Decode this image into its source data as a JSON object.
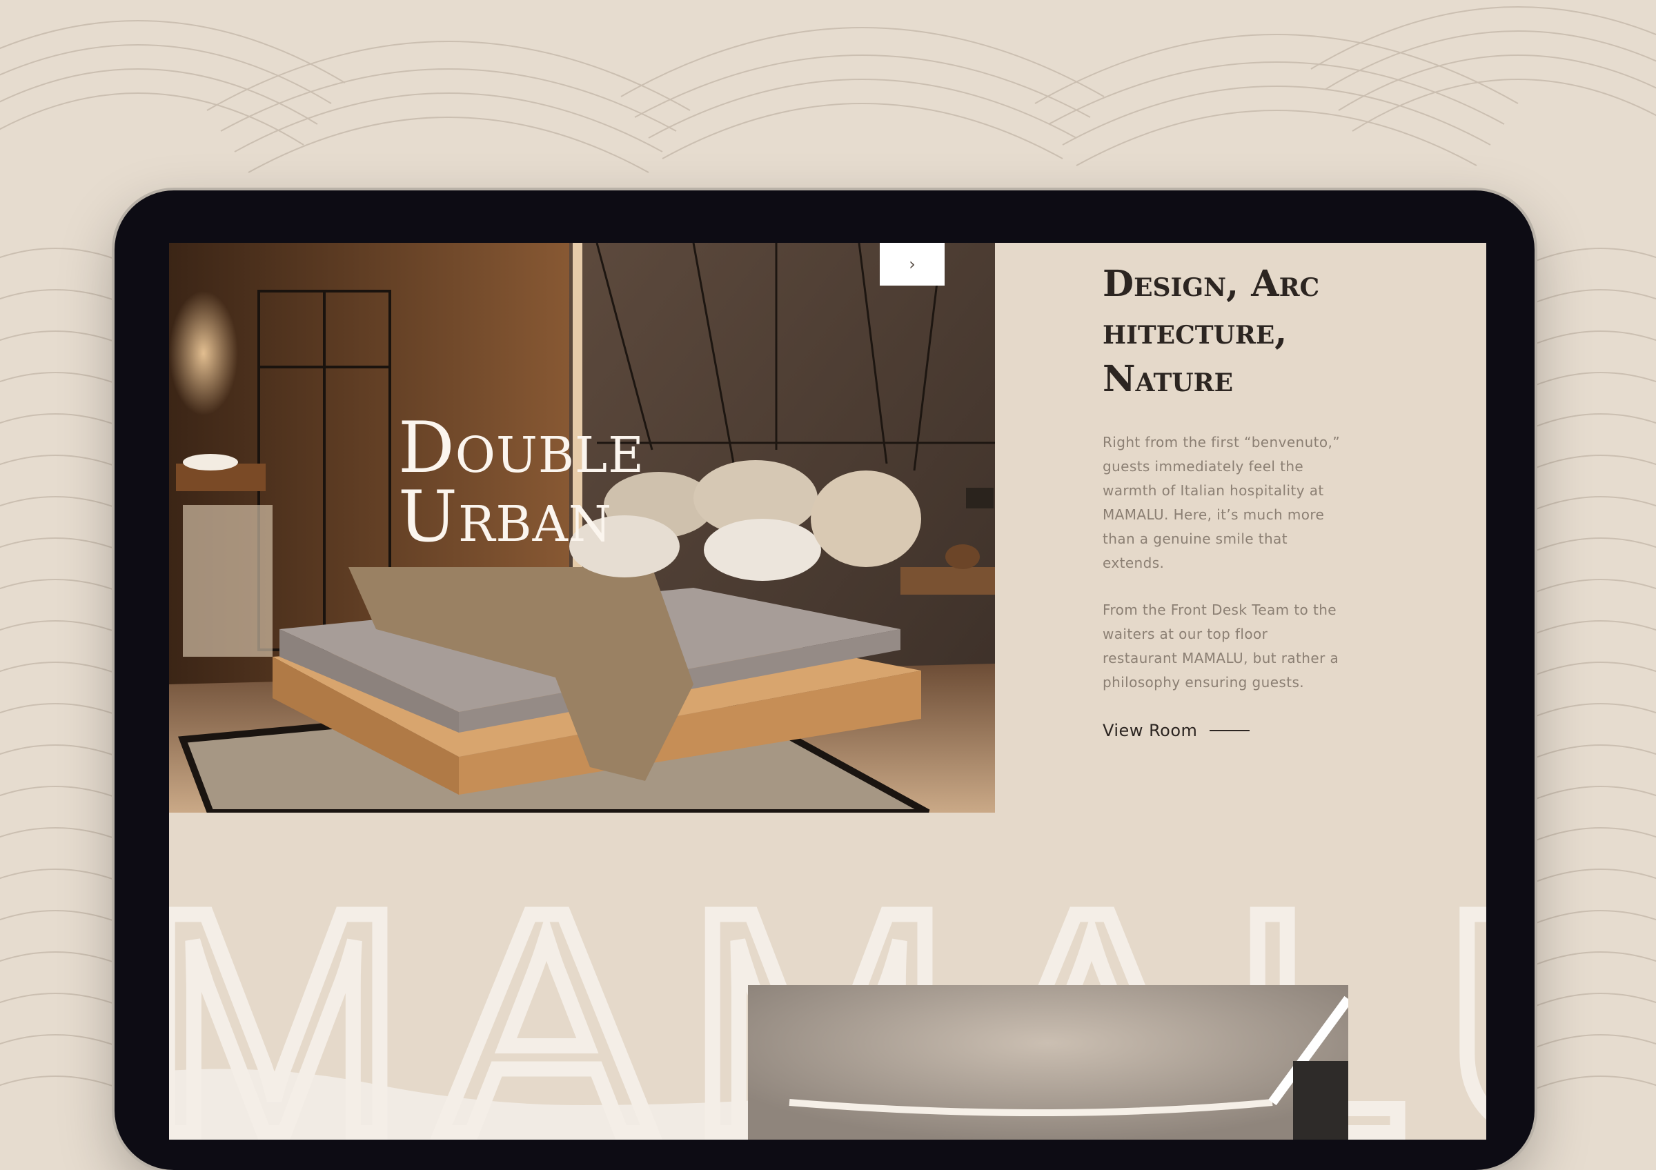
{
  "hero": {
    "title_line1": "Double",
    "title_line2": "Urban",
    "next_icon": "chevron-right-icon"
  },
  "intro": {
    "title": "Design, Architecture, Nature",
    "paragraph1": "Right from the first “benvenuto,” guests immediately feel the warmth of Italian hospitality at MAMALU. Here, it’s much more than a genuine smile that extends.",
    "paragraph2": "From the Front Desk Team to the waiters at our top floor restaurant MAMALU, but rather a philosophy ensuring guests.",
    "cta_label": "View Room"
  },
  "brand": {
    "watermark": "MAMALU"
  },
  "colors": {
    "page_background": "#e6dccf",
    "screen_background": "#e5d9ca",
    "text_dark": "#2c2521",
    "text_muted": "#8b7f73",
    "watermark": "#f1ebe4"
  }
}
